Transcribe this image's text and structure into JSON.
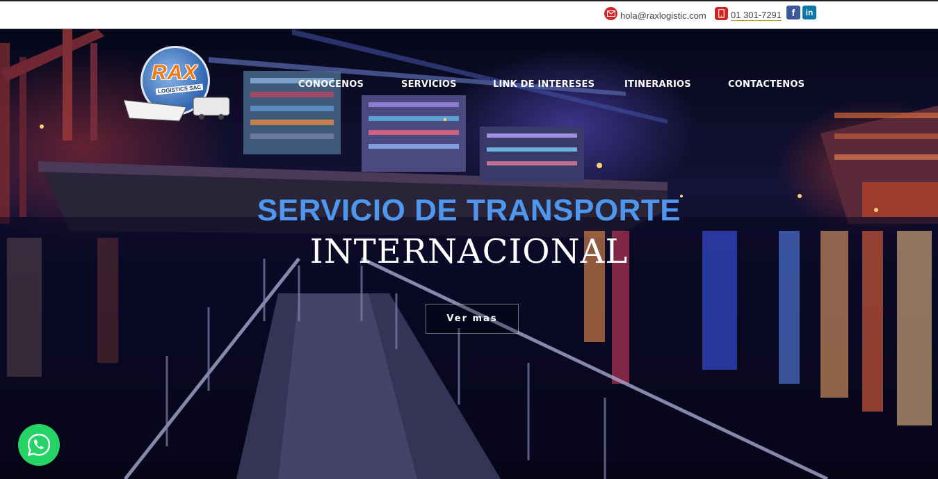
{
  "topbar": {
    "email": "hola@raxlogistic.com",
    "phone": "01 301-7291",
    "email_icon": "envelope-icon",
    "phone_icon": "mobile-phone-icon",
    "social": [
      {
        "name": "facebook-icon",
        "glyph": "f"
      },
      {
        "name": "linkedin-icon",
        "glyph": "in"
      }
    ]
  },
  "logo": {
    "brand": "RAX",
    "subtitle": "LOGISTICS SAC"
  },
  "nav": {
    "items": [
      {
        "label": "CONOCENOS"
      },
      {
        "label": "SERVICIOS"
      },
      {
        "label": "LINK DE INTERESES"
      },
      {
        "label": "ITINERARIOS"
      },
      {
        "label": "CONTACTENOS"
      }
    ]
  },
  "hero": {
    "headline_line1": "SERVICIO DE TRANSPORTE",
    "headline_line2": "INTERNACIONAL",
    "cta_label": "Ver mas"
  },
  "whatsapp": {
    "icon": "whatsapp-icon"
  },
  "colors": {
    "accent_blue": "#4f97ee",
    "brand_orange": "#f07a1a",
    "icon_red": "#d32222",
    "whatsapp_green": "#25d366"
  }
}
